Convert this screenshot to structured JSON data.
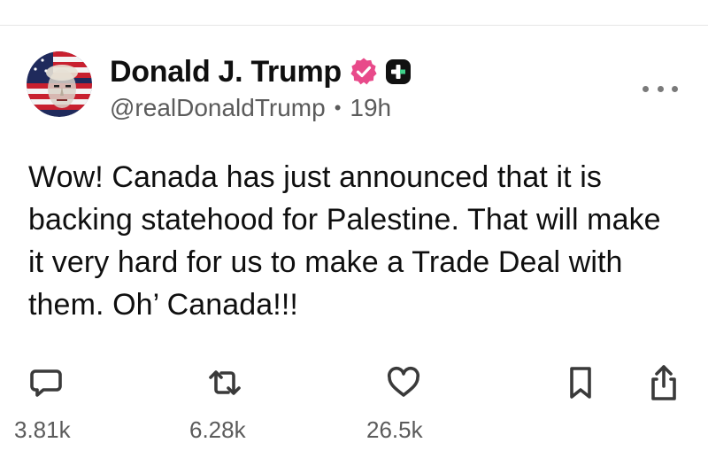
{
  "post": {
    "author": {
      "display_name": "Donald J. Trump",
      "handle": "@realDonaldTrump",
      "verified_badge_color": "#e84a8a",
      "badges": [
        "verified-icon",
        "plus-badge-icon"
      ]
    },
    "time_ago": "19h",
    "separator": "•",
    "body": "Wow! Canada has just announced that it is backing statehood for Palestine. That will make it very hard for us to make a Trade Deal with them. Oh’ Canada!!!"
  },
  "actions": {
    "replies": {
      "icon": "reply-icon",
      "count": "3.81k"
    },
    "retruths": {
      "icon": "repost-icon",
      "count": "6.28k"
    },
    "likes": {
      "icon": "heart-icon",
      "count": "26.5k"
    },
    "bookmark": {
      "icon": "bookmark-icon"
    },
    "share": {
      "icon": "share-icon"
    }
  },
  "more_menu": {
    "icon": "more-options-icon"
  }
}
